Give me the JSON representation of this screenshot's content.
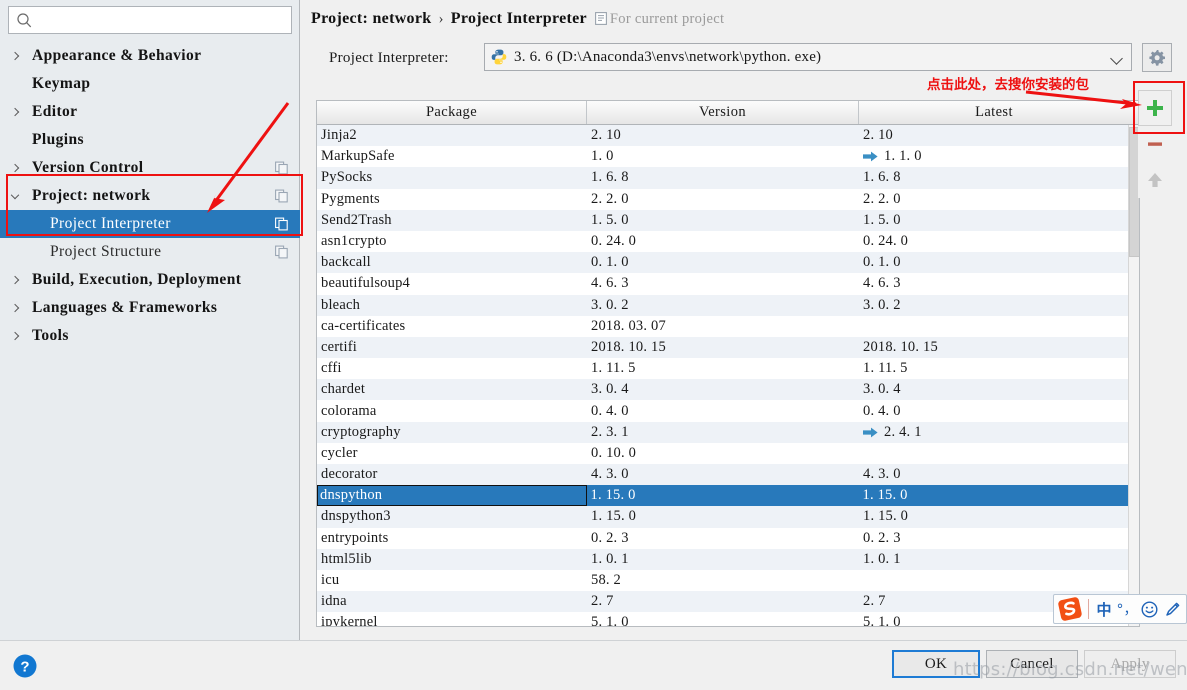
{
  "search": {
    "placeholder": "",
    "value": "",
    "icon": "search-icon"
  },
  "sidebar": {
    "items": [
      {
        "label": "Appearance & Behavior",
        "level": 1,
        "chevron": "right",
        "copy": false,
        "selected": false
      },
      {
        "label": "Keymap",
        "level": 1,
        "chevron": "none",
        "copy": false,
        "selected": false
      },
      {
        "label": "Editor",
        "level": 1,
        "chevron": "right",
        "copy": false,
        "selected": false
      },
      {
        "label": "Plugins",
        "level": 1,
        "chevron": "none",
        "copy": false,
        "selected": false
      },
      {
        "label": "Version Control",
        "level": 1,
        "chevron": "right",
        "copy": true,
        "selected": false
      },
      {
        "label": "Project: network",
        "level": 1,
        "chevron": "down",
        "copy": true,
        "selected": false
      },
      {
        "label": "Project Interpreter",
        "level": 2,
        "chevron": "none",
        "copy": true,
        "selected": true
      },
      {
        "label": "Project Structure",
        "level": 2,
        "chevron": "none",
        "copy": true,
        "selected": false
      },
      {
        "label": "Build, Execution, Deployment",
        "level": 1,
        "chevron": "right",
        "copy": false,
        "selected": false
      },
      {
        "label": "Languages & Frameworks",
        "level": 1,
        "chevron": "right",
        "copy": false,
        "selected": false
      },
      {
        "label": "Tools",
        "level": 1,
        "chevron": "right",
        "copy": false,
        "selected": false
      }
    ]
  },
  "header": {
    "breadcrumb_root": "Project: network",
    "breadcrumb_sep": "›",
    "breadcrumb_leaf": "Project Interpreter",
    "scope_note": "For current project"
  },
  "interpreter": {
    "label": "Project Interpreter:",
    "value": "3. 6. 6  (D:\\Anaconda3\\envs\\network\\python. exe)",
    "gear_icon": "gear-icon",
    "dropdown_icon": "chevron-down-icon"
  },
  "annotation": {
    "text": "点击此处，去搜你安装的包",
    "color": "#ee1111"
  },
  "table": {
    "columns": [
      "Package",
      "Version",
      "Latest"
    ],
    "rows": [
      {
        "package": "Jinja2",
        "version": "2. 10",
        "latest": "2. 10",
        "upgrade": false
      },
      {
        "package": "MarkupSafe",
        "version": "1. 0",
        "latest": "1. 1. 0",
        "upgrade": true
      },
      {
        "package": "PySocks",
        "version": "1. 6. 8",
        "latest": "1. 6. 8",
        "upgrade": false
      },
      {
        "package": "Pygments",
        "version": "2. 2. 0",
        "latest": "2. 2. 0",
        "upgrade": false
      },
      {
        "package": "Send2Trash",
        "version": "1. 5. 0",
        "latest": "1. 5. 0",
        "upgrade": false
      },
      {
        "package": "asn1crypto",
        "version": "0. 24. 0",
        "latest": "0. 24. 0",
        "upgrade": false
      },
      {
        "package": "backcall",
        "version": "0. 1. 0",
        "latest": "0. 1. 0",
        "upgrade": false
      },
      {
        "package": "beautifulsoup4",
        "version": "4. 6. 3",
        "latest": "4. 6. 3",
        "upgrade": false
      },
      {
        "package": "bleach",
        "version": "3. 0. 2",
        "latest": "3. 0. 2",
        "upgrade": false
      },
      {
        "package": "ca-certificates",
        "version": "2018. 03. 07",
        "latest": "",
        "upgrade": false
      },
      {
        "package": "certifi",
        "version": "2018. 10. 15",
        "latest": "2018. 10. 15",
        "upgrade": false
      },
      {
        "package": "cffi",
        "version": "1. 11. 5",
        "latest": "1. 11. 5",
        "upgrade": false
      },
      {
        "package": "chardet",
        "version": "3. 0. 4",
        "latest": "3. 0. 4",
        "upgrade": false
      },
      {
        "package": "colorama",
        "version": "0. 4. 0",
        "latest": "0. 4. 0",
        "upgrade": false
      },
      {
        "package": "cryptography",
        "version": "2. 3. 1",
        "latest": "2. 4. 1",
        "upgrade": true
      },
      {
        "package": "cycler",
        "version": "0. 10. 0",
        "latest": "",
        "upgrade": false
      },
      {
        "package": "decorator",
        "version": "4. 3. 0",
        "latest": "4. 3. 0",
        "upgrade": false
      },
      {
        "package": "dnspython",
        "version": "1. 15. 0",
        "latest": "1. 15. 0",
        "upgrade": false,
        "selected": true
      },
      {
        "package": "dnspython3",
        "version": "1. 15. 0",
        "latest": "1. 15. 0",
        "upgrade": false
      },
      {
        "package": "entrypoints",
        "version": "0. 2. 3",
        "latest": "0. 2. 3",
        "upgrade": false
      },
      {
        "package": "html5lib",
        "version": "1. 0. 1",
        "latest": "1. 0. 1",
        "upgrade": false
      },
      {
        "package": "icu",
        "version": "58. 2",
        "latest": "",
        "upgrade": false
      },
      {
        "package": "idna",
        "version": "2. 7",
        "latest": "2. 7",
        "upgrade": false
      },
      {
        "package": "ipykernel",
        "version": "5. 1. 0",
        "latest": "5. 1. 0",
        "upgrade": false
      }
    ]
  },
  "side_tools": [
    {
      "name": "add-package-button",
      "icon": "plus-icon",
      "color": "#3cb44b"
    },
    {
      "name": "remove-package-button",
      "icon": "minus-icon",
      "color": "#c06050"
    },
    {
      "name": "upgrade-package-button",
      "icon": "up-arrow-icon",
      "color": "#c3c3c3"
    }
  ],
  "footer": {
    "help_icon": "help-icon",
    "ok_label": "OK",
    "cancel_label": "Cancel",
    "apply_label": "Apply",
    "watermark": "https://blog.csdn.net/wenzhihua"
  },
  "ime": {
    "logo": "sogou-logo-icon",
    "mode": "中",
    "punct": "°，",
    "emoji": "☺",
    "pen": "pen-icon"
  }
}
